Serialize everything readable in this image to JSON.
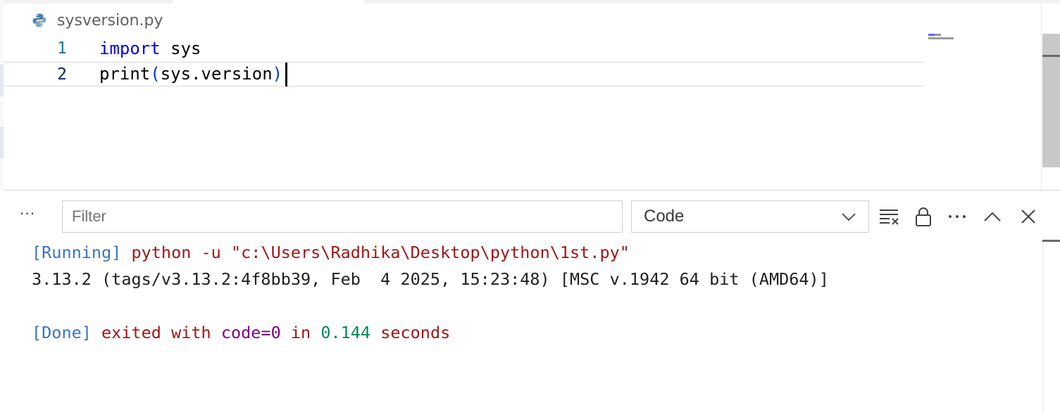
{
  "breadcrumb": {
    "file_name": "sysversion.py",
    "icon": "python-file-icon"
  },
  "editor": {
    "lines": [
      {
        "number": "1",
        "keyword": "import",
        "rest": " sys"
      },
      {
        "number": "2",
        "func": "print",
        "open": "(",
        "arg": "sys.version",
        "close": ")"
      }
    ]
  },
  "panel": {
    "filter_placeholder": "Filter",
    "channel_selected": "Code",
    "output": {
      "line1": {
        "tag": "[Running]",
        "command": " python -u \"c:\\Users\\Radhika\\Desktop\\python\\1st.py\""
      },
      "line2": "3.13.2 (tags/v3.13.2:4f8bb39, Feb  4 2025, 15:23:48) [MSC v.1942 64 bit (AMD64)]",
      "line4": {
        "tag": "[Done]",
        "exited": " exited with ",
        "code": "code=0",
        "in": " in ",
        "seconds_value": "0.144",
        "seconds": " seconds"
      }
    }
  },
  "colors": {
    "keyword": "#0000ff",
    "output_tag": "#3b73c0",
    "output_red": "#a31515",
    "output_purple": "#800080",
    "output_green": "#098658"
  }
}
